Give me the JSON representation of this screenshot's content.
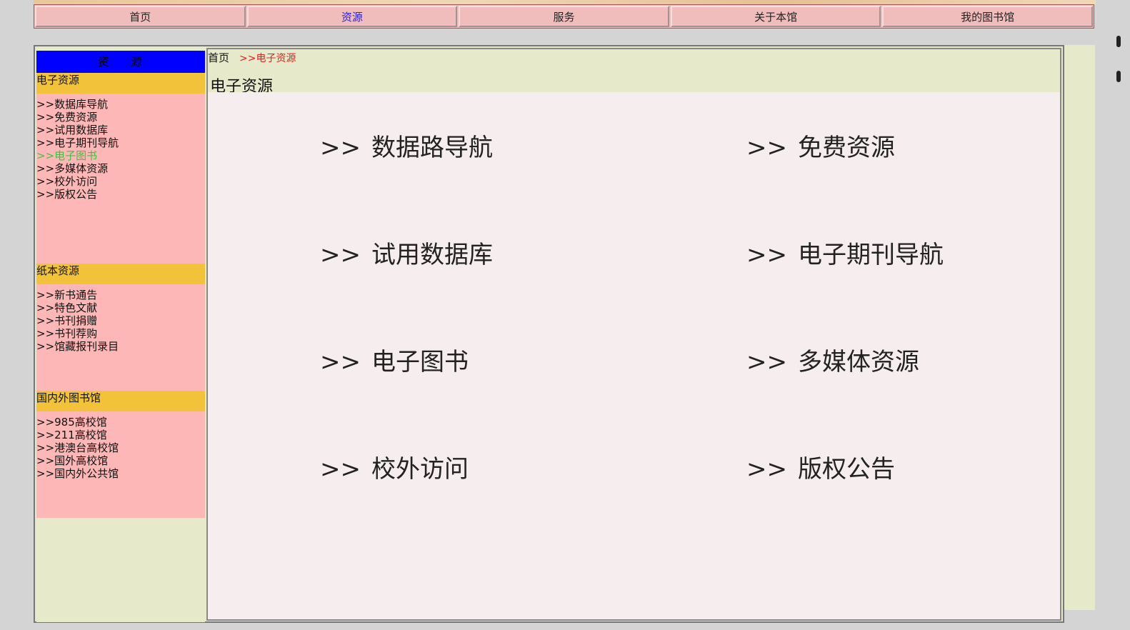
{
  "nav": {
    "items": [
      {
        "label": "首页"
      },
      {
        "label": "资源"
      },
      {
        "label": "服务"
      },
      {
        "label": "关于本馆"
      },
      {
        "label": "我的图书馆"
      }
    ]
  },
  "sidebar": {
    "header": "资    源",
    "sections": [
      {
        "title": "电子资源",
        "links": [
          ">>数据库导航",
          ">>免费资源",
          ">>试用数据库",
          ">>电子期刊导航",
          ">>电子图书",
          ">>多媒体资源",
          ">>校外访问",
          ">>版权公告"
        ]
      },
      {
        "title": "纸本资源",
        "links": [
          ">>新书通告",
          ">>特色文献",
          ">>书刊捐赠",
          ">>书刊荐购",
          ">>馆藏报刊录目"
        ]
      },
      {
        "title": "国内外图书馆",
        "links": [
          ">>985高校馆",
          ">>211高校馆",
          ">>港澳台高校馆",
          ">>国外高校馆",
          ">>国内外公共馆"
        ]
      }
    ]
  },
  "breadcrumb": {
    "home": "首页",
    "current": ">>电子资源"
  },
  "main": {
    "title": "电子资源",
    "arrow": ">>",
    "links": [
      {
        "label": "数据路导航"
      },
      {
        "label": "免费资源"
      },
      {
        "label": "试用数据库"
      },
      {
        "label": "电子期刊导航"
      },
      {
        "label": "电子图书"
      },
      {
        "label": "多媒体资源"
      },
      {
        "label": "校外访问"
      },
      {
        "label": "版权公告"
      }
    ]
  },
  "colors": {
    "nav_bg": "#f0bcbc",
    "nav_active": "#2a22e0",
    "sidebar_header": "#0000ff",
    "section_title": "#f2c33a",
    "section_body": "#fdb7b7",
    "active_link": "#3ec23e",
    "breadcrumb_current": "#e02222",
    "panel_bg": "#e6eacb",
    "content_bg": "#f6eeee"
  }
}
